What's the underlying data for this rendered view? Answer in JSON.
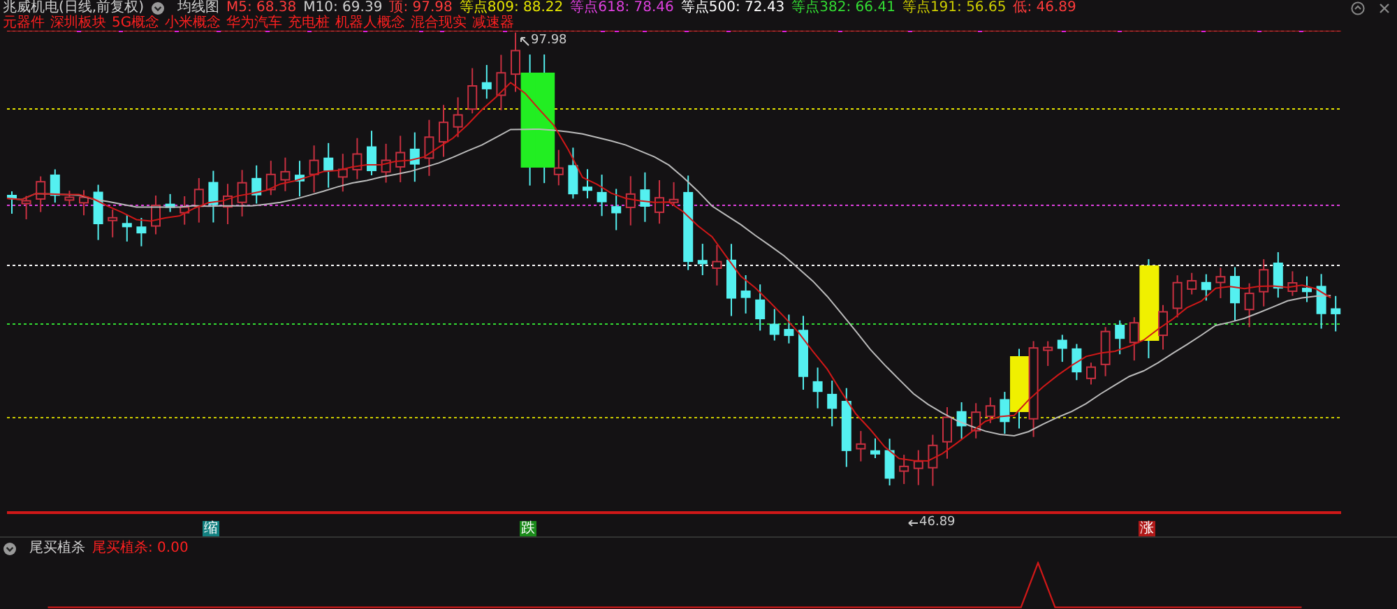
{
  "header": {
    "title": "兆威机电(日线,前复权)",
    "indicator": "均线图",
    "values": [
      {
        "label": "M5: 68.38",
        "color": "#ff3b3b"
      },
      {
        "label": "M10: 69.39",
        "color": "#cfcfcf"
      },
      {
        "label": "顶: 97.98",
        "color": "#ff3b3b"
      },
      {
        "label": "等点809: 88.22",
        "color": "#e6e600"
      },
      {
        "label": "等点618: 78.46",
        "color": "#e040e0"
      },
      {
        "label": "等点500: 72.43",
        "color": "#ffffff"
      },
      {
        "label": "等点382: 66.41",
        "color": "#33dd33"
      },
      {
        "label": "等点191: 56.65",
        "color": "#cccc00"
      },
      {
        "label": "低: 46.89",
        "color": "#ff3b3b"
      }
    ]
  },
  "tags": [
    "元器件",
    "深圳板块",
    "5G概念",
    "小米概念",
    "华为汽车",
    "充电桩",
    "机器人概念",
    "混合现实",
    "减速器"
  ],
  "chart": {
    "peak_label": "97.98",
    "low_label": "46.89"
  },
  "markers": [
    {
      "text": "缩",
      "color": "#128080"
    },
    {
      "text": "跌",
      "color": "#1a8a1a"
    },
    {
      "text": "涨",
      "color": "#b01818"
    }
  ],
  "sub_panel": {
    "title": "尾买植杀",
    "value": "尾买植杀: 0.00"
  }
}
